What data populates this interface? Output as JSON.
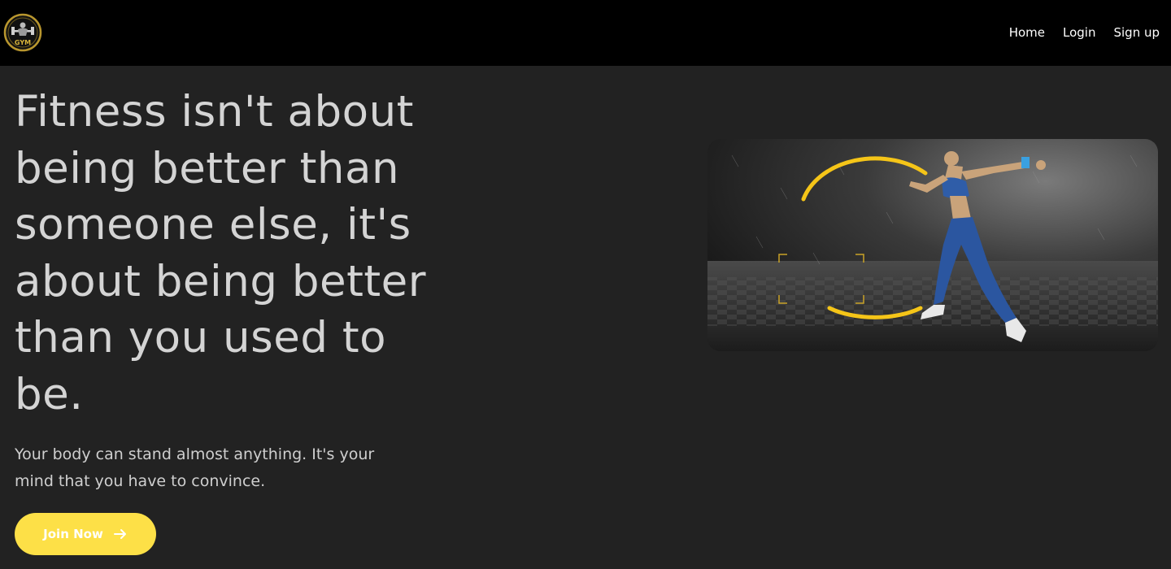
{
  "navbar": {
    "logo_text": "GYM",
    "links": [
      {
        "label": "Home"
      },
      {
        "label": "Login"
      },
      {
        "label": "Sign up"
      }
    ]
  },
  "hero": {
    "headline": "Fitness isn't about being better than someone else, it's about being better than you used to be.",
    "subtext": "Your body can stand almost anything. It's your mind that you have to convince.",
    "cta_label": "Join Now",
    "cta_icon": "arrow-right-icon",
    "image_subject": "athlete-sprinting"
  },
  "colors": {
    "navbar_bg": "#000000",
    "page_bg": "#222222",
    "accent": "#fde047",
    "text": "#d4d4d4"
  }
}
